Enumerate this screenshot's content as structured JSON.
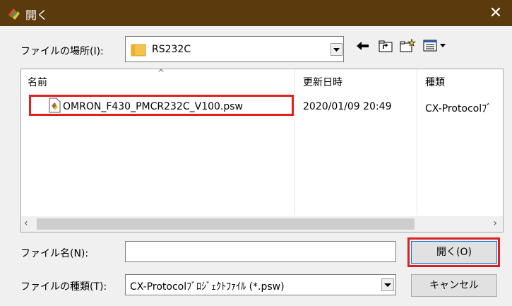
{
  "titlebar": {
    "title": "開く",
    "close_label": "✕",
    "icon": "app-icon"
  },
  "location": {
    "label": "ファイルの場所(I):",
    "value": "RS232C",
    "folder_icon": "folder-icon"
  },
  "toolbar": {
    "back_icon": "back-arrow-icon",
    "up_icon": "up-folder-icon",
    "new_folder_icon": "new-folder-icon",
    "view_icon": "view-menu-icon"
  },
  "filelist": {
    "columns": [
      "名前",
      "更新日時",
      "種類"
    ],
    "rows": [
      {
        "name": "OMRON_F430_PMCR232C_V100.psw",
        "date": "2020/01/09 20:49",
        "type": "CX-Protocolﾌﾞ"
      }
    ],
    "scroll_left": "‹",
    "scroll_right": "›",
    "sort_caret": "^"
  },
  "filename": {
    "label": "ファイル名(N):",
    "value": ""
  },
  "filetype": {
    "label": "ファイルの種類(T):",
    "value": "CX-Protocolﾌﾞﾛｼﾞｪｸﾄﾌｧｲﾙ (*.psw)"
  },
  "buttons": {
    "open": "開く(O)",
    "cancel": "キャンセル"
  },
  "colors": {
    "titlebar": "#5b3a0e",
    "highlight": "#e02020",
    "accent": "#0078d7"
  }
}
